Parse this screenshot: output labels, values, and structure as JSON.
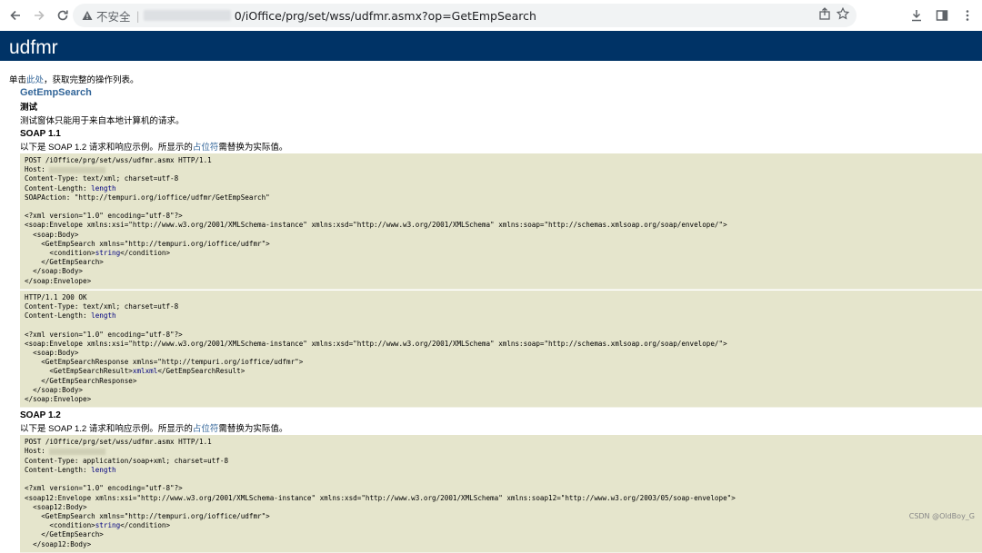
{
  "browser": {
    "insecure_label": "不安全",
    "url_path": "0/iOffice/prg/set/wss/udfmr.asmx?op=GetEmpSearch"
  },
  "page": {
    "title": "udfmr",
    "intro_prefix": "单击",
    "intro_link": "此处",
    "intro_suffix": "，获取完整的操作列表。",
    "operation": "GetEmpSearch",
    "test_label": "测试",
    "test_note": "测试窗体只能用于来自本地计算机的请求。",
    "soap11_heading": "SOAP 1.1",
    "soap11_desc_prefix": "以下是 SOAP 1.2 请求和响应示例。所显示的",
    "soap11_desc_link": "占位符",
    "soap11_desc_suffix": "需替换为实际值。",
    "soap12_heading": "SOAP 1.2",
    "soap12_desc_prefix": "以下是 SOAP 1.2 请求和响应示例。所显示的",
    "soap12_desc_link": "占位符",
    "soap12_desc_suffix": "需替换为实际值。"
  },
  "soap11_request": {
    "line1": "POST /iOffice/prg/set/wss/udfmr.asmx HTTP/1.1",
    "host": "Host: ",
    "ctype": "Content-Type: text/xml; charset=utf-8",
    "clen_prefix": "Content-Length: ",
    "clen_ph": "length",
    "action": "SOAPAction: \"http://tempuri.org/ioffice/udfmr/GetEmpSearch\"",
    "xmldecl": "<?xml version=\"1.0\" encoding=\"utf-8\"?>",
    "env_open": "<soap:Envelope xmlns:xsi=\"http://www.w3.org/2001/XMLSchema-instance\" xmlns:xsd=\"http://www.w3.org/2001/XMLSchema\" xmlns:soap=\"http://schemas.xmlsoap.org/soap/envelope/\">",
    "body_open": "  <soap:Body>",
    "op_open": "    <GetEmpSearch xmlns=\"http://tempuri.org/ioffice/udfmr\">",
    "cond_open": "      <condition>",
    "cond_ph": "string",
    "cond_close": "</condition>",
    "op_close": "    </GetEmpSearch>",
    "body_close": "  </soap:Body>",
    "env_close": "</soap:Envelope>"
  },
  "soap11_response": {
    "status": "HTTP/1.1 200 OK",
    "ctype": "Content-Type: text/xml; charset=utf-8",
    "clen_prefix": "Content-Length: ",
    "clen_ph": "length",
    "xmldecl": "<?xml version=\"1.0\" encoding=\"utf-8\"?>",
    "env_open": "<soap:Envelope xmlns:xsi=\"http://www.w3.org/2001/XMLSchema-instance\" xmlns:xsd=\"http://www.w3.org/2001/XMLSchema\" xmlns:soap=\"http://schemas.xmlsoap.org/soap/envelope/\">",
    "body_open": "  <soap:Body>",
    "resp_open": "    <GetEmpSearchResponse xmlns=\"http://tempuri.org/ioffice/udfmr\">",
    "res_open": "      <GetEmpSearchResult>",
    "res_ph": "xmlxml",
    "res_close": "</GetEmpSearchResult>",
    "resp_close": "    </GetEmpSearchResponse>",
    "body_close": "  </soap:Body>",
    "env_close": "</soap:Envelope>"
  },
  "soap12_request": {
    "line1": "POST /iOffice/prg/set/wss/udfmr.asmx HTTP/1.1",
    "host": "Host: ",
    "ctype": "Content-Type: application/soap+xml; charset=utf-8",
    "clen_prefix": "Content-Length: ",
    "clen_ph": "length",
    "xmldecl": "<?xml version=\"1.0\" encoding=\"utf-8\"?>",
    "env_open": "<soap12:Envelope xmlns:xsi=\"http://www.w3.org/2001/XMLSchema-instance\" xmlns:xsd=\"http://www.w3.org/2001/XMLSchema\" xmlns:soap12=\"http://www.w3.org/2003/05/soap-envelope\">",
    "body_open": "  <soap12:Body>",
    "op_open": "    <GetEmpSearch xmlns=\"http://tempuri.org/ioffice/udfmr\">",
    "cond_open": "      <condition>",
    "cond_ph": "string",
    "cond_close": "</condition>",
    "op_close": "    </GetEmpSearch>",
    "body_close": "  </soap12:Body>"
  },
  "watermark": "CSDN @OldBoy_G"
}
